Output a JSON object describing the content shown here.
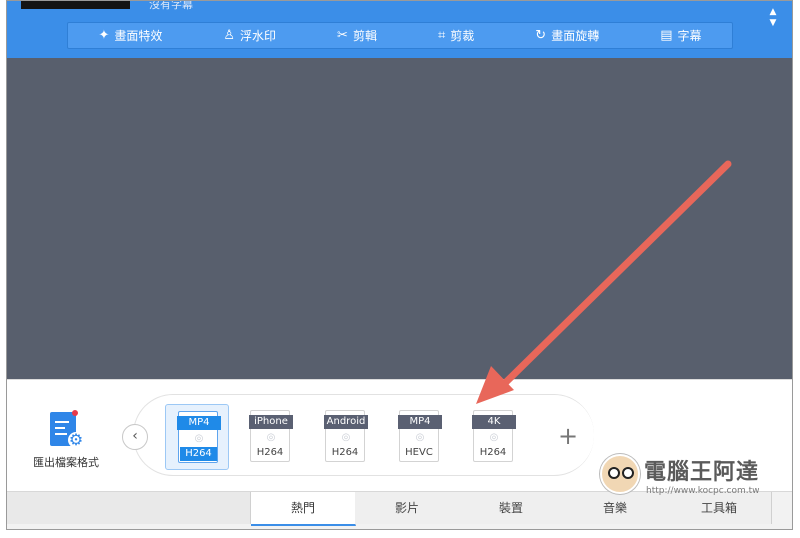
{
  "toolbar": {
    "cutoff_text": "沒有字幕",
    "scroll_up": "▲",
    "scroll_down": "▼",
    "edit_items": [
      {
        "label": "畫面特效",
        "icon": "magic-wand-icon",
        "glyph": "✦"
      },
      {
        "label": "浮水印",
        "icon": "stamp-icon",
        "glyph": "♙"
      },
      {
        "label": "剪輯",
        "icon": "scissors-icon",
        "glyph": "✂"
      },
      {
        "label": "剪裁",
        "icon": "crop-icon",
        "glyph": "⌗"
      },
      {
        "label": "畫面旋轉",
        "icon": "rotate-icon",
        "glyph": "↻"
      },
      {
        "label": "字幕",
        "icon": "subtitle-icon",
        "glyph": "▤"
      }
    ]
  },
  "export": {
    "label": "匯出檔案格式",
    "icon": "export-format-icon"
  },
  "nav": {
    "prev": "‹",
    "add": "+"
  },
  "formats": [
    {
      "top": "MP4",
      "bottom": "H264",
      "selected": true
    },
    {
      "top": "iPhone",
      "bottom": "H264",
      "selected": false
    },
    {
      "top": "Android",
      "bottom": "H264",
      "selected": false
    },
    {
      "top": "MP4",
      "bottom": "HEVC",
      "selected": false
    },
    {
      "top": "4K",
      "bottom": "H264",
      "selected": false
    }
  ],
  "tabs": [
    {
      "label": "熱門",
      "active": true
    },
    {
      "label": "影片",
      "active": false
    },
    {
      "label": "裝置",
      "active": false
    },
    {
      "label": "音樂",
      "active": false
    },
    {
      "label": "工具箱",
      "active": false
    }
  ],
  "watermark": {
    "title": "電腦王阿達",
    "url": "http://www.kocpc.com.tw"
  },
  "colors": {
    "toolbar": "#3b8ee8",
    "preview": "#585f6d",
    "accent": "#1f8ae8",
    "arrow": "#e8675a"
  }
}
